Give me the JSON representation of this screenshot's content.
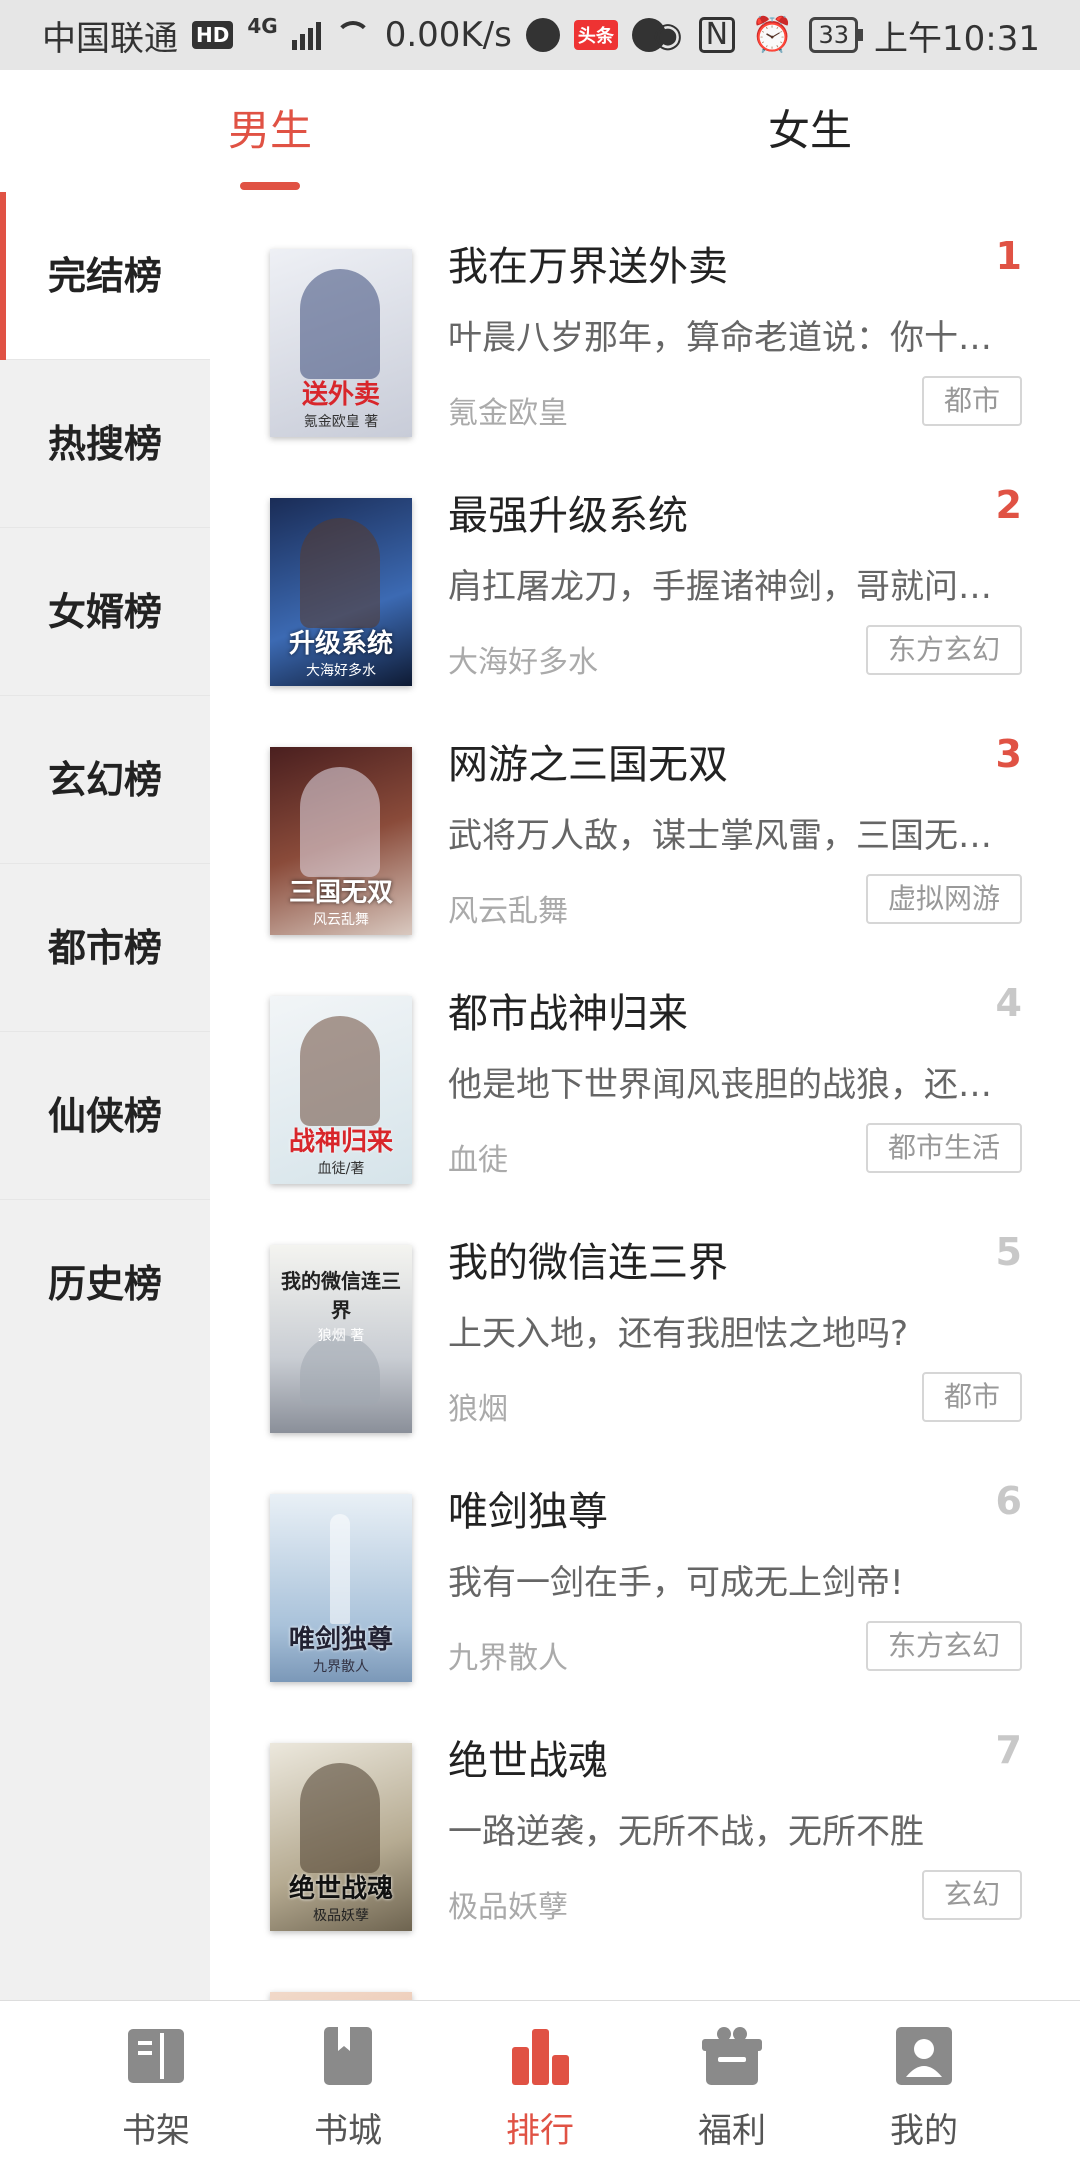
{
  "status_bar": {
    "carrier": "中国联通",
    "hd": "HD",
    "network": "4G",
    "speed": "0.00K/s",
    "toutiao": "头条",
    "battery": "33",
    "time": "上午10:31"
  },
  "top_tabs": {
    "male": "男生",
    "female": "女生",
    "active": "male"
  },
  "sidebar": {
    "items": [
      {
        "label": "完结榜",
        "active": true
      },
      {
        "label": "热搜榜",
        "active": false
      },
      {
        "label": "女婿榜",
        "active": false
      },
      {
        "label": "玄幻榜",
        "active": false
      },
      {
        "label": "都市榜",
        "active": false
      },
      {
        "label": "仙侠榜",
        "active": false
      },
      {
        "label": "历史榜",
        "active": false
      }
    ]
  },
  "books": [
    {
      "rank": "1",
      "title": "我在万界送外卖",
      "desc": "叶晨八岁那年，算命老道说：你十…",
      "author": "氪金欧皇",
      "tag": "都市",
      "cover_text": "送外卖",
      "cover_author": "氪金欧皇 著",
      "cover_color": "#d9dde6"
    },
    {
      "rank": "2",
      "title": "最强升级系统",
      "desc": "肩扛屠龙刀，手握诸神剑，哥就问…",
      "author": "大海好多水",
      "tag": "东方玄幻",
      "cover_text": "升级系统",
      "cover_author": "大海好多水",
      "cover_color": "#2f4f86"
    },
    {
      "rank": "3",
      "title": "网游之三国无双",
      "desc": "武将万人敌，谋士掌风雷，三国无…",
      "author": "风云乱舞",
      "tag": "虚拟网游",
      "cover_text": "三国无双",
      "cover_author": "风云乱舞",
      "cover_color": "#6b3b3b"
    },
    {
      "rank": "4",
      "title": "都市战神归来",
      "desc": "他是地下世界闻风丧胆的战狼，还…",
      "author": "血徒",
      "tag": "都市生活",
      "cover_text": "战神归来",
      "cover_author": "血徒/著",
      "cover_color": "#e9eef2"
    },
    {
      "rank": "5",
      "title": "我的微信连三界",
      "desc": "上天入地，还有我胆怯之地吗?",
      "author": "狼烟",
      "tag": "都市",
      "cover_text": "我的微信连三界",
      "cover_author": "狼烟 著",
      "cover_color": "#d8dde2"
    },
    {
      "rank": "6",
      "title": "唯剑独尊",
      "desc": "我有一剑在手，可成无上剑帝!",
      "author": "九界散人",
      "tag": "东方玄幻",
      "cover_text": "唯剑独尊",
      "cover_author": "九界散人",
      "cover_color": "#b9cfe3"
    },
    {
      "rank": "7",
      "title": "绝世战魂",
      "desc": "一路逆袭，无所不战，无所不胜",
      "author": "极品妖孽",
      "tag": "玄幻",
      "cover_text": "绝世战魂",
      "cover_author": "极品妖孽",
      "cover_color": "#cfc8b8"
    }
  ],
  "bottom_nav": {
    "items": [
      {
        "label": "书架",
        "icon": "bookshelf-icon"
      },
      {
        "label": "书城",
        "icon": "bookstore-icon"
      },
      {
        "label": "排行",
        "icon": "ranking-icon"
      },
      {
        "label": "福利",
        "icon": "gift-icon"
      },
      {
        "label": "我的",
        "icon": "profile-icon"
      }
    ],
    "active": "排行"
  },
  "colors": {
    "accent": "#e05244",
    "rank_inactive": "#c8c8c8"
  }
}
